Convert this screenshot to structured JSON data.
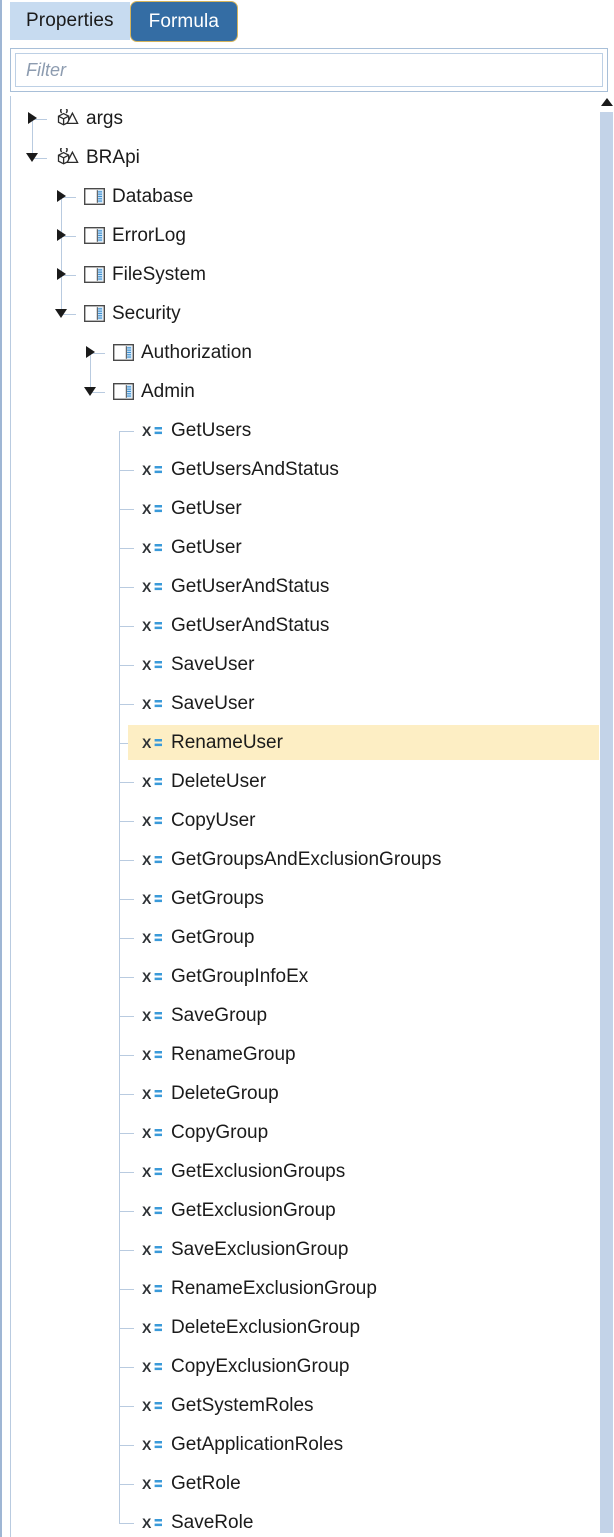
{
  "tabs": [
    {
      "label": "Properties",
      "active": false,
      "name": "tab-properties"
    },
    {
      "label": "Formula",
      "active": true,
      "name": "tab-formula"
    }
  ],
  "filter": {
    "value": "",
    "placeholder": "Filter"
  },
  "colors": {
    "tab_active_bg": "#346da4",
    "tab_active_border": "#d5b45c",
    "tab_inactive_bg": "#c7dbf0",
    "highlight_row_bg": "#fdeec4",
    "tree_line": "#b9cbe0",
    "scrollbar_track": "#c3d3e8",
    "method_icon_accent": "#3a9ad9",
    "text": "#1b1b1b"
  },
  "scrollbar": {
    "up_arrow_icon": "scroll-up-arrow-icon",
    "orientation": "vertical"
  },
  "tree": [
    {
      "label": "args",
      "kind": "namespace",
      "depth": 0,
      "state": "collapsed",
      "icon": "namespace-icon",
      "highlight": false
    },
    {
      "label": "BRApi",
      "kind": "namespace",
      "depth": 0,
      "state": "expanded",
      "icon": "namespace-icon",
      "highlight": false
    },
    {
      "label": "Database",
      "kind": "class",
      "depth": 1,
      "state": "collapsed",
      "icon": "class-icon",
      "highlight": false
    },
    {
      "label": "ErrorLog",
      "kind": "class",
      "depth": 1,
      "state": "collapsed",
      "icon": "class-icon",
      "highlight": false
    },
    {
      "label": "FileSystem",
      "kind": "class",
      "depth": 1,
      "state": "collapsed",
      "icon": "class-icon",
      "highlight": false
    },
    {
      "label": "Security",
      "kind": "class",
      "depth": 1,
      "state": "expanded",
      "icon": "class-icon",
      "highlight": false
    },
    {
      "label": "Authorization",
      "kind": "class",
      "depth": 2,
      "state": "collapsed",
      "icon": "class-icon",
      "highlight": false
    },
    {
      "label": "Admin",
      "kind": "class",
      "depth": 2,
      "state": "expanded",
      "icon": "class-icon",
      "highlight": false
    },
    {
      "label": "GetUsers",
      "kind": "method",
      "depth": 3,
      "state": "leaf",
      "icon": "method-icon",
      "highlight": false
    },
    {
      "label": "GetUsersAndStatus",
      "kind": "method",
      "depth": 3,
      "state": "leaf",
      "icon": "method-icon",
      "highlight": false
    },
    {
      "label": "GetUser",
      "kind": "method",
      "depth": 3,
      "state": "leaf",
      "icon": "method-icon",
      "highlight": false
    },
    {
      "label": "GetUser",
      "kind": "method",
      "depth": 3,
      "state": "leaf",
      "icon": "method-icon",
      "highlight": false
    },
    {
      "label": "GetUserAndStatus",
      "kind": "method",
      "depth": 3,
      "state": "leaf",
      "icon": "method-icon",
      "highlight": false
    },
    {
      "label": "GetUserAndStatus",
      "kind": "method",
      "depth": 3,
      "state": "leaf",
      "icon": "method-icon",
      "highlight": false
    },
    {
      "label": "SaveUser",
      "kind": "method",
      "depth": 3,
      "state": "leaf",
      "icon": "method-icon",
      "highlight": false
    },
    {
      "label": "SaveUser",
      "kind": "method",
      "depth": 3,
      "state": "leaf",
      "icon": "method-icon",
      "highlight": false
    },
    {
      "label": "RenameUser",
      "kind": "method",
      "depth": 3,
      "state": "leaf",
      "icon": "method-icon",
      "highlight": true
    },
    {
      "label": "DeleteUser",
      "kind": "method",
      "depth": 3,
      "state": "leaf",
      "icon": "method-icon",
      "highlight": false
    },
    {
      "label": "CopyUser",
      "kind": "method",
      "depth": 3,
      "state": "leaf",
      "icon": "method-icon",
      "highlight": false
    },
    {
      "label": "GetGroupsAndExclusionGroups",
      "kind": "method",
      "depth": 3,
      "state": "leaf",
      "icon": "method-icon",
      "highlight": false
    },
    {
      "label": "GetGroups",
      "kind": "method",
      "depth": 3,
      "state": "leaf",
      "icon": "method-icon",
      "highlight": false
    },
    {
      "label": "GetGroup",
      "kind": "method",
      "depth": 3,
      "state": "leaf",
      "icon": "method-icon",
      "highlight": false
    },
    {
      "label": "GetGroupInfoEx",
      "kind": "method",
      "depth": 3,
      "state": "leaf",
      "icon": "method-icon",
      "highlight": false
    },
    {
      "label": "SaveGroup",
      "kind": "method",
      "depth": 3,
      "state": "leaf",
      "icon": "method-icon",
      "highlight": false
    },
    {
      "label": "RenameGroup",
      "kind": "method",
      "depth": 3,
      "state": "leaf",
      "icon": "method-icon",
      "highlight": false
    },
    {
      "label": "DeleteGroup",
      "kind": "method",
      "depth": 3,
      "state": "leaf",
      "icon": "method-icon",
      "highlight": false
    },
    {
      "label": "CopyGroup",
      "kind": "method",
      "depth": 3,
      "state": "leaf",
      "icon": "method-icon",
      "highlight": false
    },
    {
      "label": "GetExclusionGroups",
      "kind": "method",
      "depth": 3,
      "state": "leaf",
      "icon": "method-icon",
      "highlight": false
    },
    {
      "label": "GetExclusionGroup",
      "kind": "method",
      "depth": 3,
      "state": "leaf",
      "icon": "method-icon",
      "highlight": false
    },
    {
      "label": "SaveExclusionGroup",
      "kind": "method",
      "depth": 3,
      "state": "leaf",
      "icon": "method-icon",
      "highlight": false
    },
    {
      "label": "RenameExclusionGroup",
      "kind": "method",
      "depth": 3,
      "state": "leaf",
      "icon": "method-icon",
      "highlight": false
    },
    {
      "label": "DeleteExclusionGroup",
      "kind": "method",
      "depth": 3,
      "state": "leaf",
      "icon": "method-icon",
      "highlight": false
    },
    {
      "label": "CopyExclusionGroup",
      "kind": "method",
      "depth": 3,
      "state": "leaf",
      "icon": "method-icon",
      "highlight": false
    },
    {
      "label": "GetSystemRoles",
      "kind": "method",
      "depth": 3,
      "state": "leaf",
      "icon": "method-icon",
      "highlight": false
    },
    {
      "label": "GetApplicationRoles",
      "kind": "method",
      "depth": 3,
      "state": "leaf",
      "icon": "method-icon",
      "highlight": false
    },
    {
      "label": "GetRole",
      "kind": "method",
      "depth": 3,
      "state": "leaf",
      "icon": "method-icon",
      "highlight": false
    },
    {
      "label": "SaveRole",
      "kind": "method",
      "depth": 3,
      "state": "leaf",
      "icon": "method-icon",
      "highlight": false
    }
  ]
}
